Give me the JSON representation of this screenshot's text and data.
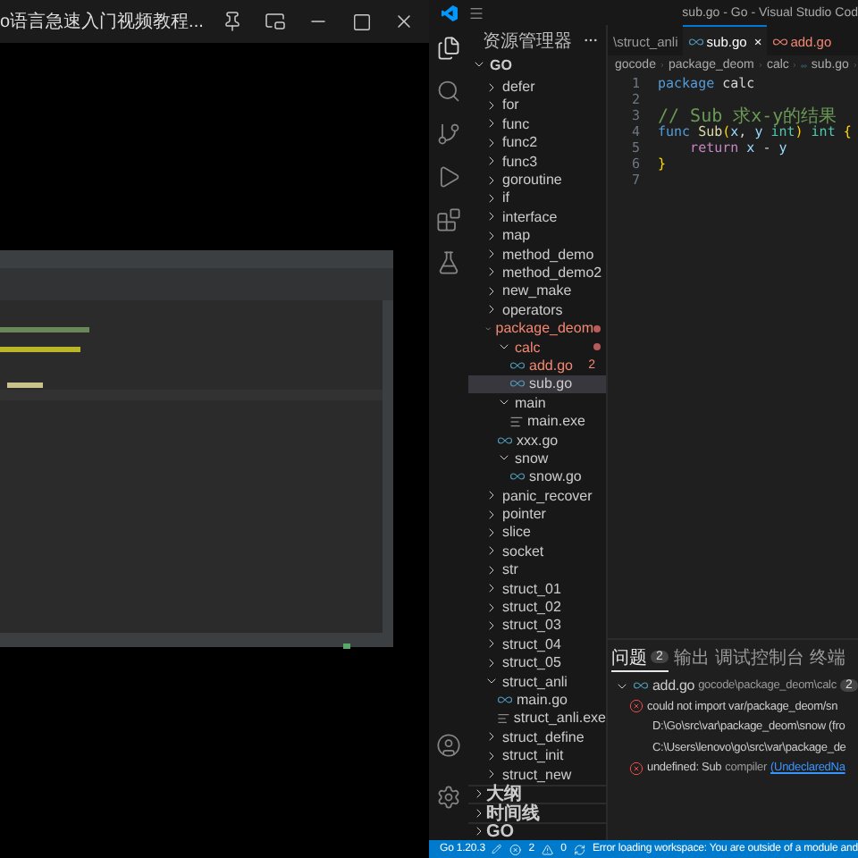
{
  "player": {
    "title": "o语言急速入门视频教程..."
  },
  "vscode": {
    "title": "sub.go - Go - Visual Studio Cod",
    "explorer": {
      "header": "资源管理器",
      "root": "GO",
      "items": [
        {
          "name": "defer",
          "kind": "folder",
          "expanded": false,
          "selected": false
        },
        {
          "name": "for",
          "kind": "folder",
          "expanded": false,
          "selected": false
        },
        {
          "name": "func",
          "kind": "folder",
          "expanded": false,
          "selected": false
        },
        {
          "name": "func2",
          "kind": "folder",
          "expanded": false,
          "selected": false
        },
        {
          "name": "func3",
          "kind": "folder",
          "expanded": false,
          "selected": false
        },
        {
          "name": "goroutine",
          "kind": "folder",
          "expanded": false,
          "selected": false
        },
        {
          "name": "if",
          "kind": "folder",
          "expanded": false,
          "selected": false
        },
        {
          "name": "interface",
          "kind": "folder",
          "expanded": false,
          "selected": false
        },
        {
          "name": "map",
          "kind": "folder",
          "expanded": false,
          "selected": false
        },
        {
          "name": "method_demo",
          "kind": "folder",
          "expanded": false,
          "selected": false
        },
        {
          "name": "method_demo2",
          "kind": "folder",
          "expanded": false,
          "selected": false
        },
        {
          "name": "new_make",
          "kind": "folder",
          "expanded": false,
          "selected": false
        },
        {
          "name": "operators",
          "kind": "folder",
          "expanded": false,
          "selected": false
        },
        {
          "name": "package_deom",
          "kind": "folder",
          "expanded": true,
          "selected": false,
          "error": true,
          "children": [
            {
              "name": "calc",
              "kind": "folder",
              "expanded": true,
              "selected": false,
              "error": true,
              "children": [
                {
                  "name": "add.go",
                  "kind": "go",
                  "selected": false,
                  "error": true,
                  "badge": "2"
                },
                {
                  "name": "sub.go",
                  "kind": "go",
                  "selected": true
                }
              ]
            },
            {
              "name": "main",
              "kind": "folder",
              "expanded": true,
              "selected": false,
              "children": [
                {
                  "name": "main.exe",
                  "kind": "exe",
                  "selected": false
                }
              ]
            },
            {
              "name": "xxx.go",
              "kind": "go",
              "selected": false
            },
            {
              "name": "snow",
              "kind": "folder",
              "expanded": true,
              "selected": false,
              "children": [
                {
                  "name": "snow.go",
                  "kind": "go",
                  "selected": false
                }
              ]
            }
          ]
        },
        {
          "name": "panic_recover",
          "kind": "folder",
          "expanded": false,
          "selected": false
        },
        {
          "name": "pointer",
          "kind": "folder",
          "expanded": false,
          "selected": false
        },
        {
          "name": "slice",
          "kind": "folder",
          "expanded": false,
          "selected": false
        },
        {
          "name": "socket",
          "kind": "folder",
          "expanded": false,
          "selected": false
        },
        {
          "name": "str",
          "kind": "folder",
          "expanded": false,
          "selected": false
        },
        {
          "name": "struct_01",
          "kind": "folder",
          "expanded": false,
          "selected": false
        },
        {
          "name": "struct_02",
          "kind": "folder",
          "expanded": false,
          "selected": false
        },
        {
          "name": "struct_03",
          "kind": "folder",
          "expanded": false,
          "selected": false
        },
        {
          "name": "struct_04",
          "kind": "folder",
          "expanded": false,
          "selected": false
        },
        {
          "name": "struct_05",
          "kind": "folder",
          "expanded": false,
          "selected": false
        },
        {
          "name": "struct_anli",
          "kind": "folder",
          "expanded": true,
          "selected": false,
          "children": [
            {
              "name": "main.go",
              "kind": "go",
              "selected": false
            },
            {
              "name": "struct_anli.exe",
              "kind": "exe",
              "selected": false
            }
          ]
        },
        {
          "name": "struct_define",
          "kind": "folder",
          "expanded": false,
          "selected": false
        },
        {
          "name": "struct_init",
          "kind": "folder",
          "expanded": false,
          "selected": false
        },
        {
          "name": "struct_new",
          "kind": "folder",
          "expanded": false,
          "selected": false
        }
      ],
      "sections": [
        "大纲",
        "时间线",
        "GO"
      ]
    },
    "tabs": [
      {
        "label": "\\struct_anli",
        "selected": false
      },
      {
        "label": "sub.go",
        "selected": true,
        "close": "×"
      },
      {
        "label": "add.go",
        "selected": false,
        "error": true
      }
    ],
    "breadcrumb": [
      "gocode",
      "package_deom",
      "calc",
      "sub.go"
    ],
    "code": [
      {
        "n": "1",
        "tokens": [
          {
            "t": "package ",
            "kind": "keyword"
          },
          {
            "t": "calc",
            "kind": "plain"
          }
        ]
      },
      {
        "n": "2"
      },
      {
        "n": "3",
        "tokens": [
          {
            "t": "// Sub 求x-y的结果",
            "kind": "comment"
          }
        ]
      },
      {
        "n": "4",
        "tokens": [
          {
            "t": "func ",
            "kind": "keyword"
          },
          {
            "t": "Sub",
            "kind": "function"
          },
          {
            "t": "(",
            "kind": "brace"
          },
          {
            "t": "x",
            "kind": "variable"
          },
          {
            "t": ", ",
            "kind": "plain"
          },
          {
            "t": "y ",
            "kind": "variable"
          },
          {
            "t": "int",
            "kind": "type"
          },
          {
            "t": ") ",
            "kind": "brace"
          },
          {
            "t": "int ",
            "kind": "type"
          },
          {
            "t": "{",
            "kind": "brace"
          }
        ]
      },
      {
        "n": "5",
        "tokens": [
          {
            "t": "    return ",
            "kind": "control"
          },
          {
            "t": "x",
            "kind": "variable"
          },
          {
            "t": " - ",
            "kind": "plain"
          },
          {
            "t": "y",
            "kind": "variable"
          }
        ]
      },
      {
        "n": "6",
        "tokens": [
          {
            "t": "}",
            "kind": "brace"
          }
        ]
      },
      {
        "n": "7"
      }
    ],
    "panel": {
      "tabs": [
        {
          "label": "问题",
          "badge": "2",
          "selected": true
        },
        {
          "label": "输出",
          "selected": false
        },
        {
          "label": "调试控制台",
          "selected": false
        },
        {
          "label": "终端",
          "selected": false
        }
      ],
      "group": {
        "file": "add.go",
        "path": "gocode\\package_deom\\calc",
        "count": "2"
      },
      "problems": [
        {
          "kind": "error",
          "text": "could not import var/package_deom/sn"
        },
        {
          "kind": "detail",
          "text": "D:\\Go\\src\\var\\package_deom\\snow (fro"
        },
        {
          "kind": "detail",
          "text": "C:\\Users\\lenovo\\go\\src\\var\\package_de"
        },
        {
          "kind": "error",
          "text": "undefined: Sub",
          "source": "compiler",
          "link": "(UndeclaredNa"
        }
      ]
    },
    "status": {
      "go": "Go 1.20.3",
      "errors": "2",
      "warnings": "0",
      "message": "Error loading workspace: You are outside of a module and"
    }
  }
}
